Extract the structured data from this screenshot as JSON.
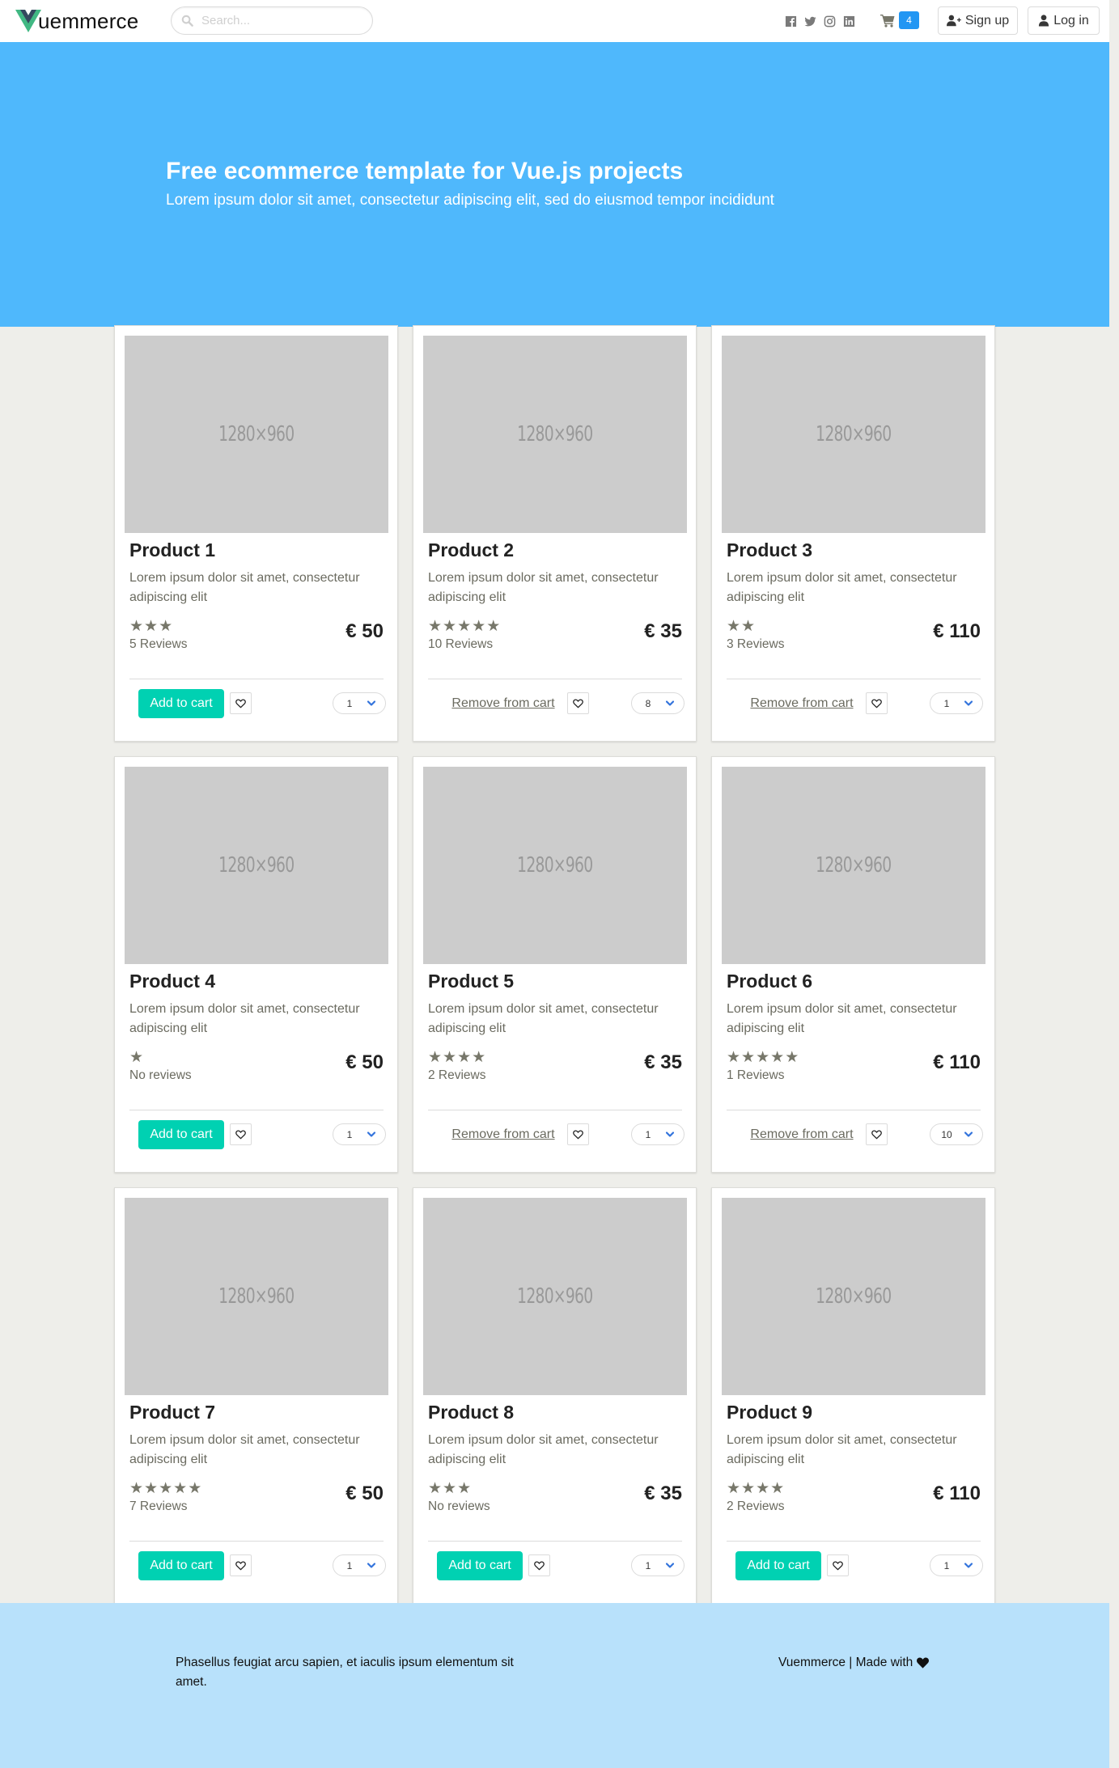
{
  "header": {
    "brand": "uemmerce",
    "brand_full": "Vuemmerce",
    "search_placeholder": "Search...",
    "search_value": "",
    "socials": [
      "facebook",
      "twitter",
      "instagram",
      "linkedin"
    ],
    "cart_count": "4",
    "signup_label": "Sign up",
    "login_label": "Log in"
  },
  "hero": {
    "title": "Free ecommerce template for Vue.js projects",
    "subtitle": "Lorem ipsum dolor sit amet, consectetur adipiscing elit, sed do eiusmod tempor incididunt"
  },
  "colors": {
    "hero": "#4fb8fc",
    "add_button": "#00d1b2",
    "badge": "#2196f3",
    "footer": "#b8e1fb",
    "star": "#77776a"
  },
  "products": [
    {
      "title": "Product 1",
      "desc": "Lorem ipsum dolor sit amet, consectetur adipiscing elit",
      "stars": 3,
      "reviews": "5 Reviews",
      "price": "€ 50",
      "in_cart": false,
      "action_label": "Add to cart",
      "qty": "1",
      "image_label": "1280×960"
    },
    {
      "title": "Product 2",
      "desc": "Lorem ipsum dolor sit amet, consectetur adipiscing elit",
      "stars": 5,
      "reviews": "10 Reviews",
      "price": "€ 35",
      "in_cart": true,
      "action_label": "Remove from cart",
      "qty": "8",
      "image_label": "1280×960"
    },
    {
      "title": "Product 3",
      "desc": "Lorem ipsum dolor sit amet, consectetur adipiscing elit",
      "stars": 2,
      "reviews": "3 Reviews",
      "price": "€ 110",
      "in_cart": true,
      "action_label": "Remove from cart",
      "qty": "1",
      "image_label": "1280×960"
    },
    {
      "title": "Product 4",
      "desc": "Lorem ipsum dolor sit amet, consectetur adipiscing elit",
      "stars": 1,
      "reviews": "No reviews",
      "price": "€ 50",
      "in_cart": false,
      "action_label": "Add to cart",
      "qty": "1",
      "image_label": "1280×960"
    },
    {
      "title": "Product 5",
      "desc": "Lorem ipsum dolor sit amet, consectetur adipiscing elit",
      "stars": 4,
      "reviews": "2 Reviews",
      "price": "€ 35",
      "in_cart": true,
      "action_label": "Remove from cart",
      "qty": "1",
      "image_label": "1280×960"
    },
    {
      "title": "Product 6",
      "desc": "Lorem ipsum dolor sit amet, consectetur adipiscing elit",
      "stars": 5,
      "reviews": "1 Reviews",
      "price": "€ 110",
      "in_cart": true,
      "action_label": "Remove from cart",
      "qty": "10",
      "image_label": "1280×960"
    },
    {
      "title": "Product 7",
      "desc": "Lorem ipsum dolor sit amet, consectetur adipiscing elit",
      "stars": 5,
      "reviews": "7 Reviews",
      "price": "€ 50",
      "in_cart": false,
      "action_label": "Add to cart",
      "qty": "1",
      "image_label": "1280×960"
    },
    {
      "title": "Product 8",
      "desc": "Lorem ipsum dolor sit amet, consectetur adipiscing elit",
      "stars": 3,
      "reviews": "No reviews",
      "price": "€ 35",
      "in_cart": false,
      "action_label": "Add to cart",
      "qty": "1",
      "image_label": "1280×960"
    },
    {
      "title": "Product 9",
      "desc": "Lorem ipsum dolor sit amet, consectetur adipiscing elit",
      "stars": 4,
      "reviews": "2 Reviews",
      "price": "€ 110",
      "in_cart": false,
      "action_label": "Add to cart",
      "qty": "1",
      "image_label": "1280×960"
    }
  ],
  "footer": {
    "left_text": "Phasellus feugiat arcu sapien, et iaculis ipsum elementum sit amet.",
    "right_text": "Vuemmerce | Made with",
    "right_icon": "heart-icon"
  }
}
